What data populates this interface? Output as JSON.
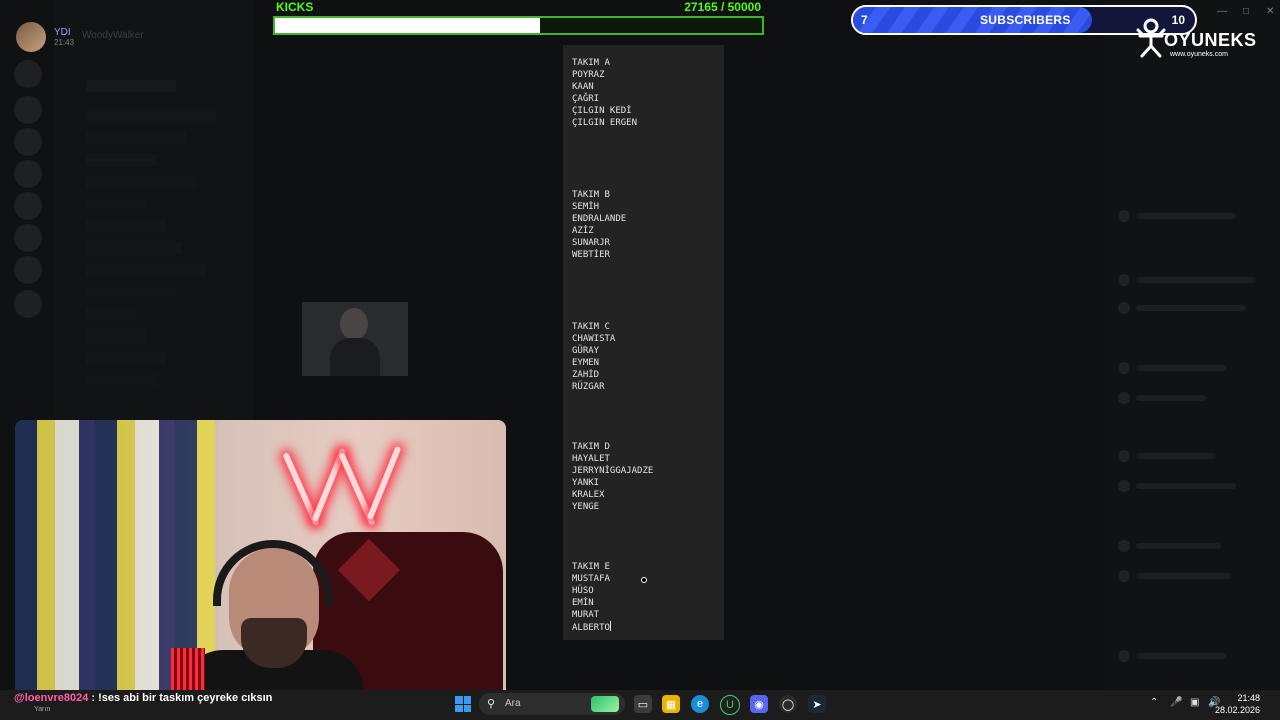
{
  "discord": {
    "user_name": "YDI",
    "user_time": "21:43",
    "server_name": "WoodyWalker"
  },
  "kicks": {
    "label": "KICKS",
    "count_text": "27165  / 50000",
    "current": 27165,
    "goal": 50000,
    "bar_color": "#53fc18"
  },
  "subscribers": {
    "current": "7",
    "label": "SUBSCRIBERS",
    "goal": "10",
    "progress": 0.7,
    "bar_color": "#2a4be0"
  },
  "logo": {
    "name": "OYUNEKS",
    "url": "www.oyuneks.com",
    "icon": "mascot-icon"
  },
  "notepad": {
    "teams": [
      {
        "title": "TAKIM A",
        "members": [
          "POYRAZ",
          "KAAN",
          "ÇAĞRI",
          "ÇILGIN KEDİ",
          "ÇILGIN ERGEN"
        ]
      },
      {
        "title": "TAKIM B",
        "members": [
          "SEMİH",
          "ENDRALANDE",
          "AZİZ",
          "SUNARJR",
          "WEBTİER"
        ]
      },
      {
        "title": "TAKIM C",
        "members": [
          "CHAWISTA",
          "GÜRAY",
          "EYMEN",
          "ZAHİD",
          "RÜZGAR"
        ]
      },
      {
        "title": "TAKIM D",
        "members": [
          "HAYALET",
          "JERRYNİGGAJADZE",
          "YANKI",
          "KRALEX",
          "YENGE"
        ]
      },
      {
        "title": "TAKIM E",
        "members": [
          "MUSTAFA",
          "HÜSO",
          "EMİN",
          "MURAT",
          "ALBERTO"
        ]
      }
    ]
  },
  "chat": {
    "user": "@loenvre8024",
    "message": " : !ses abi bir taskım çeyreke cıksın",
    "sub": "Yarın"
  },
  "taskbar": {
    "search_placeholder": "Ara",
    "time": "21:48",
    "date": "28.02.2026"
  }
}
